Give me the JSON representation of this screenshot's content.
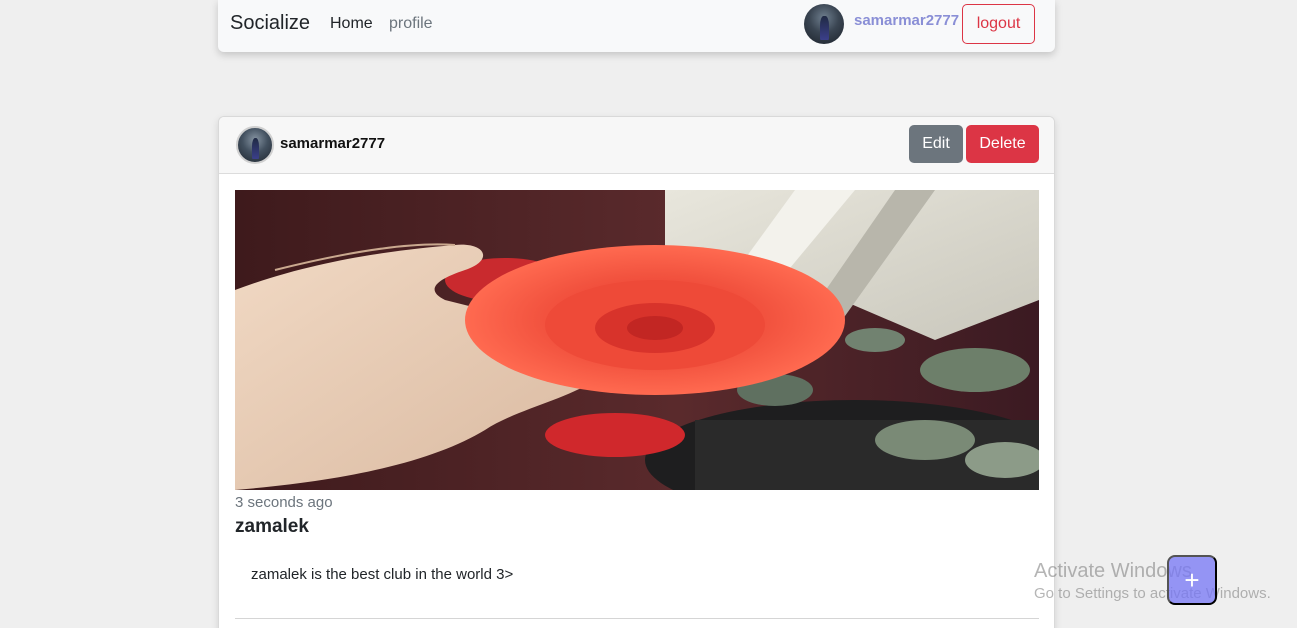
{
  "navbar": {
    "brand": "Socialize",
    "links": {
      "home": "Home",
      "profile": "profile"
    },
    "username": "samarmar2777",
    "logout_label": "logout"
  },
  "post": {
    "username": "samarmar2777",
    "edit_label": "Edit",
    "delete_label": "Delete",
    "timestamp": "3 seconds ago",
    "title": "zamalek",
    "body": "zamalek is the best club in the world 3>"
  },
  "overlay": {
    "watermark_title": "Activate Windows",
    "watermark_subtitle": "Go to Settings to activate Windows.",
    "fab_icon": "plus-icon",
    "fab_symbol": "+"
  },
  "colors": {
    "danger": "#dc3545",
    "secondary": "#6c757d",
    "username_accent": "#8a8fd6",
    "fab": "#7676f6"
  }
}
